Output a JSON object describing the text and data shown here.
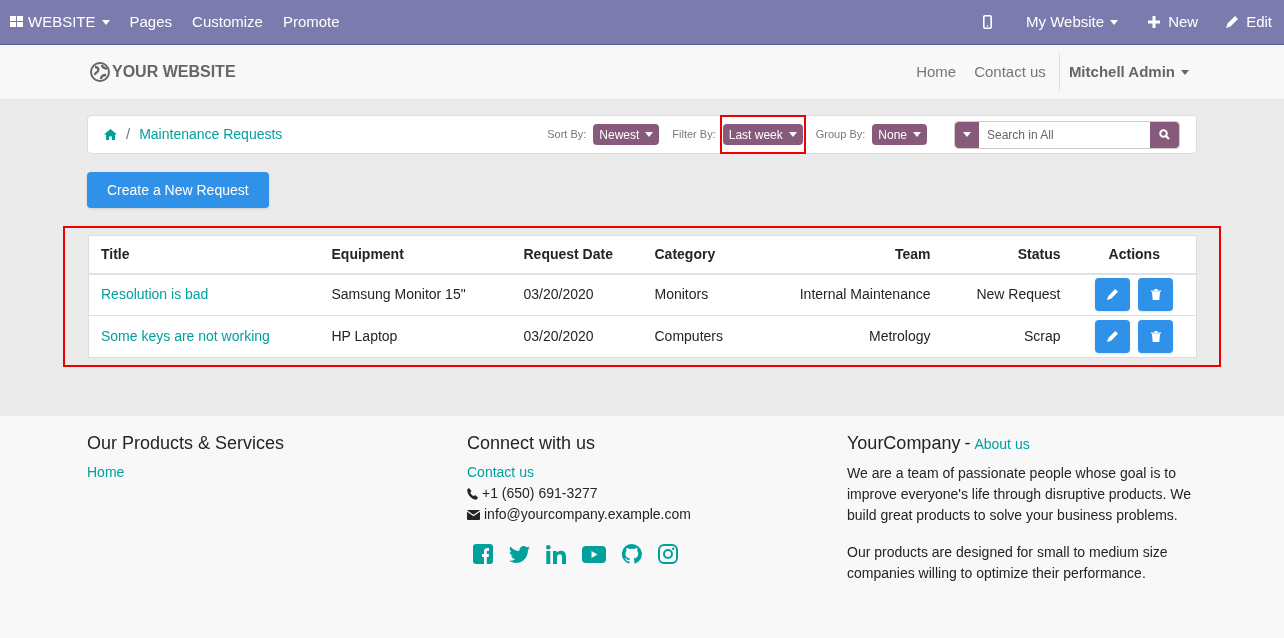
{
  "topbar": {
    "menu": [
      {
        "label": "WEBSITE",
        "kind": "apps"
      },
      {
        "label": "Pages",
        "kind": "plain"
      },
      {
        "label": "Customize",
        "kind": "plain"
      },
      {
        "label": "Promote",
        "kind": "plain"
      }
    ],
    "right": [
      {
        "kind": "mobile"
      },
      {
        "label": "My Website",
        "kind": "dropdown"
      },
      {
        "label": "New",
        "kind": "new"
      },
      {
        "label": "Edit",
        "kind": "edit"
      }
    ]
  },
  "header": {
    "logo": "YOUR WEBSITE",
    "links": [
      "Home",
      "Contact us"
    ],
    "user": "Mitchell Admin"
  },
  "breadcrumb": {
    "separator": "/",
    "current": "Maintenance Requests"
  },
  "filters": [
    {
      "label": "Sort By:",
      "value": "Newest",
      "highlighted": false
    },
    {
      "label": "Filter By:",
      "value": "Last week",
      "highlighted": true
    },
    {
      "label": "Group By:",
      "value": "None",
      "highlighted": false
    }
  ],
  "search": {
    "placeholder": "Search in All"
  },
  "create_button": "Create a New Request",
  "table": {
    "highlighted": true,
    "columns": [
      "Title",
      "Equipment",
      "Request Date",
      "Category",
      "Team",
      "Status",
      "Actions"
    ],
    "rows": [
      {
        "title": "Resolution is bad",
        "equipment": "Samsung Monitor 15\"",
        "date": "03/20/2020",
        "category": "Monitors",
        "team": "Internal Maintenance",
        "status": "New Request"
      },
      {
        "title": "Some keys are not working",
        "equipment": "HP Laptop",
        "date": "03/20/2020",
        "category": "Computers",
        "team": "Metrology",
        "status": "Scrap"
      }
    ]
  },
  "footer": {
    "products": {
      "title": "Our Products & Services",
      "links": [
        "Home"
      ]
    },
    "connect": {
      "title": "Connect with us",
      "link": "Contact us",
      "phone": "+1 (650) 691-3277",
      "email": "info@yourcompany.example.com"
    },
    "company": {
      "name": "YourCompany",
      "separator": "-",
      "about": "About us",
      "paragraphs": [
        "We are a team of passionate people whose goal is to improve everyone's life through disruptive products. We build great products to solve your business problems.",
        "Our products are designed for small to medium size companies willing to optimize their performance."
      ]
    }
  }
}
